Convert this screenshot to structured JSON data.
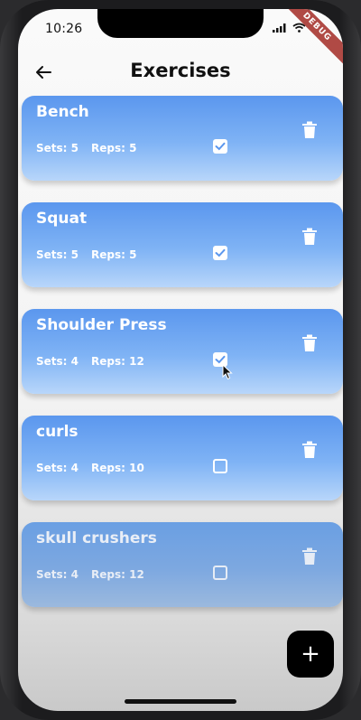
{
  "status": {
    "time": "10:26",
    "debug_label": "DEBUG"
  },
  "appbar": {
    "title": "Exercises"
  },
  "exercises": [
    {
      "name": "Bench",
      "sets": "Sets: 5",
      "reps": "Reps: 5",
      "completed": true
    },
    {
      "name": "Squat",
      "sets": "Sets: 5",
      "reps": "Reps: 5",
      "completed": true
    },
    {
      "name": "Shoulder Press",
      "sets": "Sets: 4",
      "reps": "Reps: 12",
      "completed": true
    },
    {
      "name": "curls",
      "sets": "Sets: 4",
      "reps": "Reps: 10",
      "completed": false
    },
    {
      "name": "skull crushers",
      "sets": "Sets: 4",
      "reps": "Reps: 12",
      "completed": false
    }
  ],
  "fab": {
    "label": "+"
  },
  "colors": {
    "card_top": "#5b97ee",
    "card_bottom": "#b8d6fa",
    "fab": "#000000"
  },
  "icons": {
    "back": "arrow-left-icon",
    "delete": "trash-icon",
    "add": "plus-icon"
  }
}
